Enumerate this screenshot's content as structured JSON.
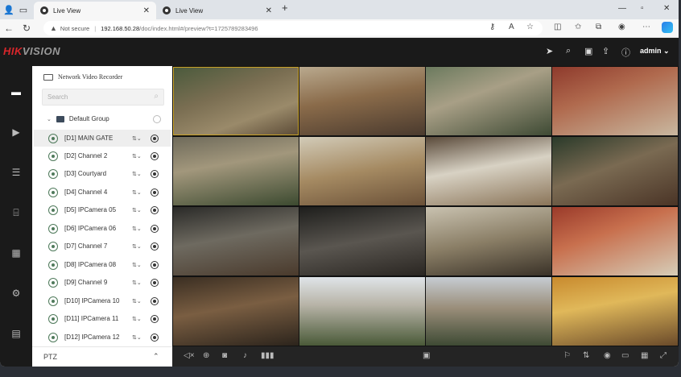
{
  "browser": {
    "tabs": [
      {
        "title": "Live View",
        "active": true
      },
      {
        "title": "Live View",
        "active": false
      }
    ],
    "security_label": "Not secure",
    "url_host": "192.168.50.28",
    "url_path": "/doc/index.html#/preview?t=1725789283496"
  },
  "app": {
    "brand": {
      "red": "HIK",
      "grey": "VISION"
    },
    "user": "admin ⌄"
  },
  "tree": {
    "title": "Network Video Recorder",
    "search_placeholder": "Search",
    "group": "Default Group",
    "channels": [
      "[D1] MAIN GATE",
      "[D2] Channel 2",
      "[D3] Courtyard",
      "[D4] Channel 4",
      "[D5] IPCamera 05",
      "[D6] IPCamera 06",
      "[D7] Channel 7",
      "[D8] IPCamera 08",
      "[D9] Channel 9",
      "[D10] IPCamera 10",
      "[D11] IPCamera 11",
      "[D12] IPCamera 12"
    ],
    "ptz_label": "PTZ"
  },
  "colors": {
    "brand_red": "#d9262b",
    "selected_tile_border": "#c9a227"
  }
}
